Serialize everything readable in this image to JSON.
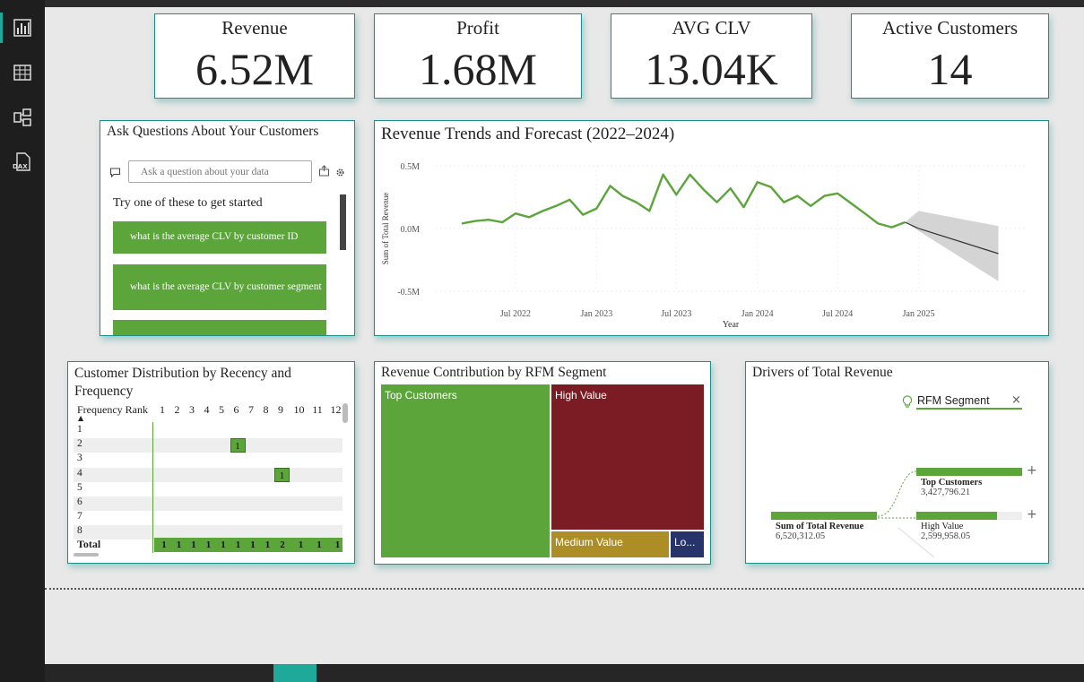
{
  "kpis": [
    {
      "title": "Revenue",
      "value": "6.52M"
    },
    {
      "title": "Profit",
      "value": "1.68M"
    },
    {
      "title": "AVG CLV",
      "value": "13.04K"
    },
    {
      "title": "Active Customers",
      "value": "14"
    }
  ],
  "qa": {
    "title": "Ask Questions About Your Customers",
    "placeholder": "Ask a question about your data",
    "try_text": "Try one of these to get started",
    "suggestions": [
      "what is the average CLV by customer ID",
      "what is the average CLV by customer segment"
    ]
  },
  "trend": {
    "title": "Revenue Trends and Forecast (2022–2024)",
    "ylabel": "Sum of Total Revenue",
    "xlabel": "Year",
    "yticks": [
      "0.5M",
      "0.0M",
      "-0.5M"
    ],
    "xticks": [
      "Jul 2022",
      "Jan 2023",
      "Jul 2023",
      "Jan 2024",
      "Jul 2024",
      "Jan 2025"
    ]
  },
  "matrix": {
    "title": "Customer Distribution by Recency and Frequency",
    "corner": "Frequency Rank",
    "columns": [
      "1",
      "2",
      "3",
      "4",
      "5",
      "6",
      "7",
      "8",
      "9",
      "10",
      "11",
      "12"
    ],
    "rows": [
      "1",
      "2",
      "3",
      "4",
      "5",
      "6",
      "7",
      "8"
    ],
    "total_label": "Total",
    "total_values": [
      "1",
      "1",
      "1",
      "1",
      "1",
      "1",
      "1",
      "1",
      "2",
      "1",
      "1",
      "1"
    ],
    "cell_value": "1"
  },
  "treemap": {
    "title": "Revenue Contribution by RFM Segment",
    "segments": [
      "Top Customers",
      "High Value",
      "Medium Value",
      "Lo..."
    ],
    "colors": [
      "#5ba53b",
      "#7b1c24",
      "#ad8e26",
      "#27346b"
    ]
  },
  "decomp": {
    "title": "Drivers of Total Revenue",
    "field": "RFM Segment",
    "root_label": "Sum of Total Revenue",
    "root_value": "6,520,312.05",
    "children": [
      {
        "label": "Top Customers",
        "value": "3,427,796.21"
      },
      {
        "label": "High Value",
        "value": "2,599,958.05"
      }
    ]
  },
  "chart_data": {
    "type": "line",
    "title": "Revenue Trends and Forecast (2022–2024)",
    "xlabel": "Year",
    "ylabel": "Sum of Total Revenue",
    "ylim": [
      -0.5,
      0.5
    ],
    "x": [
      "2022-03",
      "2022-04",
      "2022-05",
      "2022-06",
      "2022-07",
      "2022-08",
      "2022-09",
      "2022-10",
      "2022-11",
      "2022-12",
      "2023-01",
      "2023-02",
      "2023-03",
      "2023-04",
      "2023-05",
      "2023-06",
      "2023-07",
      "2023-08",
      "2023-09",
      "2023-10",
      "2023-11",
      "2023-12",
      "2024-01",
      "2024-02",
      "2024-03",
      "2024-04",
      "2024-05",
      "2024-06",
      "2024-07",
      "2024-08",
      "2024-09",
      "2024-10",
      "2024-11",
      "2024-12"
    ],
    "series": [
      {
        "values": [
          0.04,
          0.06,
          0.07,
          0.05,
          0.12,
          0.09,
          0.14,
          0.18,
          0.23,
          0.11,
          0.16,
          0.34,
          0.26,
          0.21,
          0.14,
          0.43,
          0.27,
          0.43,
          0.31,
          0.21,
          0.32,
          0.17,
          0.37,
          0.33,
          0.21,
          0.26,
          0.18,
          0.26,
          0.28,
          0.2,
          0.12,
          0.04,
          0.01,
          0.05
        ]
      }
    ],
    "forecast": {
      "x": [
        "2025-01",
        "2025-07"
      ],
      "values": [
        0.0,
        -0.2
      ],
      "upper": [
        0.14,
        0.02
      ],
      "lower": [
        -0.02,
        -0.42
      ]
    }
  }
}
